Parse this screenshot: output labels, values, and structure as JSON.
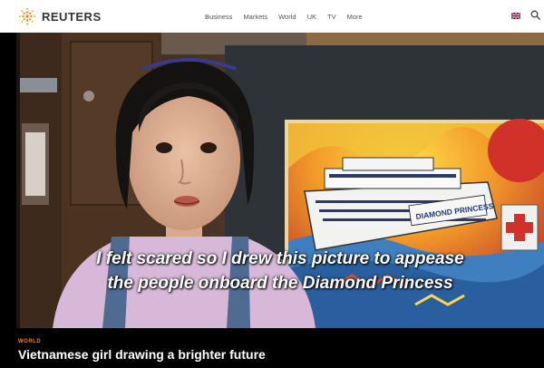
{
  "brand": {
    "name": "REUTERS",
    "color": "#ff8000"
  },
  "nav": {
    "items": [
      {
        "label": "Business"
      },
      {
        "label": "Markets"
      },
      {
        "label": "World"
      },
      {
        "label": "UK"
      },
      {
        "label": "TV"
      },
      {
        "label": "More"
      }
    ]
  },
  "header_icons": {
    "flag": "uk-flag-icon",
    "search": "search-icon"
  },
  "video": {
    "subtitle_line1": "I felt scared so I drew this picture to appease",
    "subtitle_line2": "the people onboard the Diamond Princess",
    "painting_text": "DIAMOND PRINCESS"
  },
  "story": {
    "section": "WORLD",
    "title": "Vietnamese girl drawing a brighter future"
  }
}
